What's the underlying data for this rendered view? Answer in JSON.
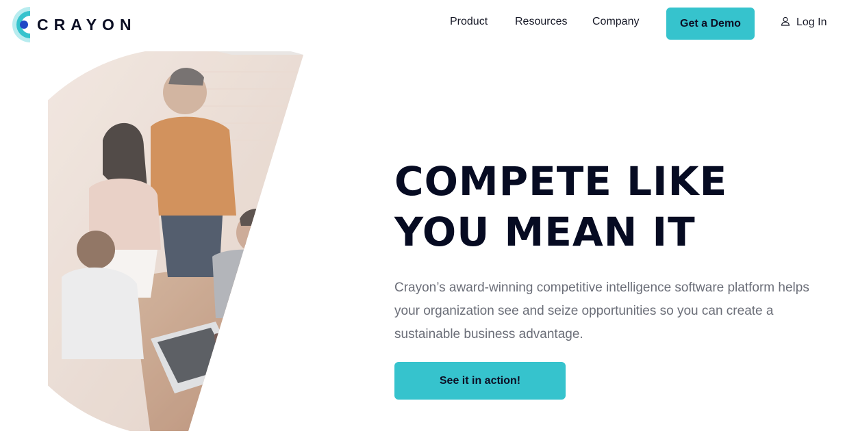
{
  "brand": {
    "name": "CRAYON",
    "logo_icon": "crayon-c-logo-icon",
    "colors": {
      "accent": "#36c3cd",
      "ink": "#060b22",
      "logo_dot": "#1f47c6"
    }
  },
  "nav": {
    "items": [
      {
        "label": "Product"
      },
      {
        "label": "Resources"
      },
      {
        "label": "Company"
      }
    ],
    "demo_label": "Get a Demo",
    "login_label": "Log In",
    "login_icon": "user-icon"
  },
  "hero": {
    "headline": "COMPETE LIKE YOU MEAN IT",
    "subcopy": "Crayon’s award-winning competitive intelligence software platform helps your organization see and seize opportunities so you can create a sustainable business advantage.",
    "cta_label": "See it in action!",
    "image_subject": "team-collaboration-photo"
  }
}
